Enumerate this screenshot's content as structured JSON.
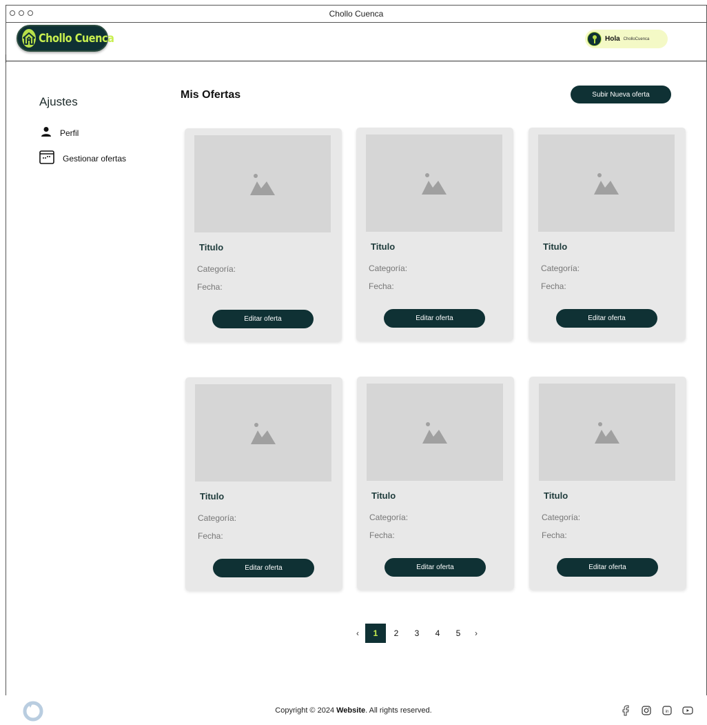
{
  "window": {
    "title": "Chollo Cuenca"
  },
  "header": {
    "logo_text": "Chollo Cuenca",
    "greeting": "Hola",
    "username": "CholloCuenca"
  },
  "sidebar": {
    "title": "Ajustes",
    "items": [
      {
        "label": "Perfil",
        "icon": "user-icon"
      },
      {
        "label": "Gestionar ofertas",
        "icon": "calendar-icon"
      }
    ]
  },
  "main": {
    "title": "Mis Ofertas",
    "upload_button": "Subir Nueva oferta",
    "cards": [
      {
        "title": "Titulo",
        "category": "Categoría:",
        "date": "Fecha:",
        "button": "Editar oferta"
      },
      {
        "title": "Titulo",
        "category": "Categoría:",
        "date": "Fecha:",
        "button": "Editar oferta"
      },
      {
        "title": "Titulo",
        "category": "Categoría:",
        "date": "Fecha:",
        "button": "Editar oferta"
      },
      {
        "title": "Titulo",
        "category": "Categoría:",
        "date": "Fecha:",
        "button": "Editar oferta"
      },
      {
        "title": "Titulo",
        "category": "Categoría:",
        "date": "Fecha:",
        "button": "Editar oferta"
      },
      {
        "title": "Titulo",
        "category": "Categoría:",
        "date": "Fecha:",
        "button": "Editar oferta"
      }
    ]
  },
  "pagination": {
    "prev": "‹",
    "next": "›",
    "pages": [
      "1",
      "2",
      "3",
      "4",
      "5"
    ],
    "current": "1"
  },
  "footer": {
    "copyright_prefix": "Copyright © 2024 ",
    "copyright_brand": "Website",
    "copyright_suffix": ". All rights reserved.",
    "socials": [
      "facebook-icon",
      "instagram-icon",
      "linkedin-icon",
      "youtube-icon"
    ]
  },
  "colors": {
    "primary": "#0f3134",
    "accent": "#c8ef4f",
    "card_bg": "#e8e8e8",
    "image_placeholder": "#d6d6d6"
  }
}
